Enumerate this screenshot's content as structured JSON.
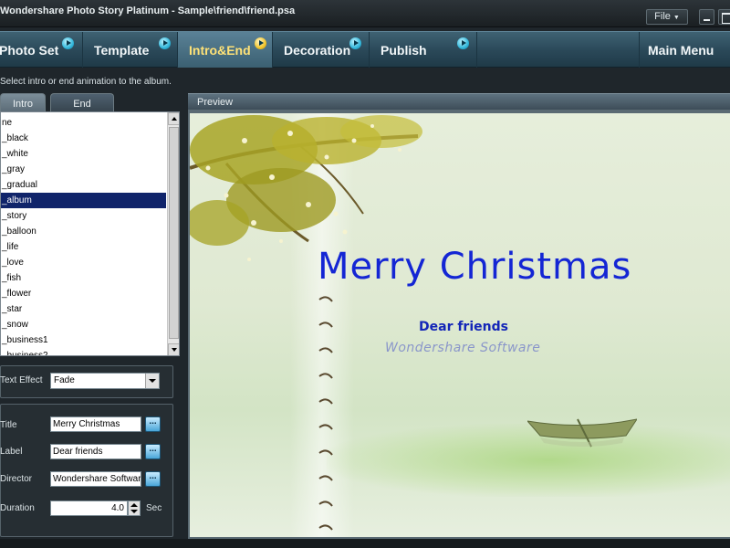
{
  "window": {
    "title": "Wondershare Photo Story Platinum - Sample\\friend\\friend.psa",
    "file_menu": "File"
  },
  "nav": {
    "tabs": [
      {
        "label": "Photo Set"
      },
      {
        "label": "Template"
      },
      {
        "label": "Intro&End"
      },
      {
        "label": "Decoration"
      },
      {
        "label": "Publish"
      }
    ],
    "active": "Intro&End",
    "main_menu": "Main Menu"
  },
  "hint": "Select intro or end animation to the album.",
  "subtabs": {
    "intro": "Intro",
    "end": "End"
  },
  "animation_list": {
    "items": [
      "ne",
      "_black",
      "_white",
      "_gray",
      "_gradual",
      "_album",
      "_story",
      "_balloon",
      "_life",
      "_love",
      "_fish",
      "_flower",
      "_star",
      "_snow",
      "_business1",
      "_business2"
    ],
    "selected_index": 5
  },
  "text_effect": {
    "label": "Text Effect",
    "value": "Fade"
  },
  "fields": {
    "title": {
      "label": "Title",
      "value": "Merry Christmas"
    },
    "label": {
      "label": "Label",
      "value": "Dear friends"
    },
    "director": {
      "label": "Director",
      "value": "Wondershare Software"
    },
    "duration": {
      "label": "Duration",
      "value": "4.0",
      "unit": "Sec"
    },
    "browse_glyph": "..."
  },
  "preview": {
    "header": "Preview",
    "title": "Merry Christmas",
    "label": "Dear friends",
    "director": "Wondershare Software"
  },
  "colors": {
    "title_text": "#1426d4",
    "active_tab_text": "#ffe277",
    "list_selection": "#10246a"
  },
  "icons": {
    "nav_arrow": "arrow-right-circle-icon",
    "browse": "ellipsis-icon",
    "minimize": "minimize-icon",
    "maximize": "maximize-icon"
  }
}
